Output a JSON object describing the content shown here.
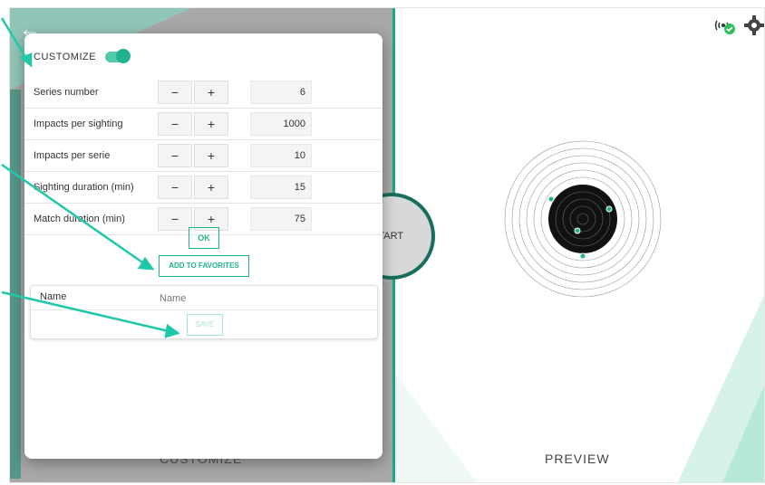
{
  "header": {
    "back_icon": "arrow-left-icon",
    "status_icons": [
      "wifi-connected-icon",
      "gear-icon"
    ]
  },
  "left": {
    "bottom_label": "CUSTOMIZE",
    "start_label": "START"
  },
  "panel": {
    "customize_label": "CUSTOMIZE",
    "toggle_on": true,
    "rows": [
      {
        "label": "Series number",
        "minus": "−",
        "plus": "+",
        "value": "6"
      },
      {
        "label": "Impacts per sighting",
        "minus": "−",
        "plus": "+",
        "value": "1000"
      },
      {
        "label": "Impacts per serie",
        "minus": "−",
        "plus": "+",
        "value": "10"
      },
      {
        "label": "Sighting duration (min)",
        "minus": "−",
        "plus": "+",
        "value": "15"
      },
      {
        "label": "Match duration (min)",
        "minus": "−",
        "plus": "+",
        "value": "75"
      }
    ],
    "ok_label": "OK",
    "favorites_label": "ADD TO FAVORITES",
    "name_label": "Name",
    "name_placeholder": "Name",
    "save_label": "SAVE"
  },
  "right": {
    "preview_label": "PREVIEW"
  },
  "colors": {
    "accent": "#20b38e",
    "dark_accent": "#176e5c"
  }
}
